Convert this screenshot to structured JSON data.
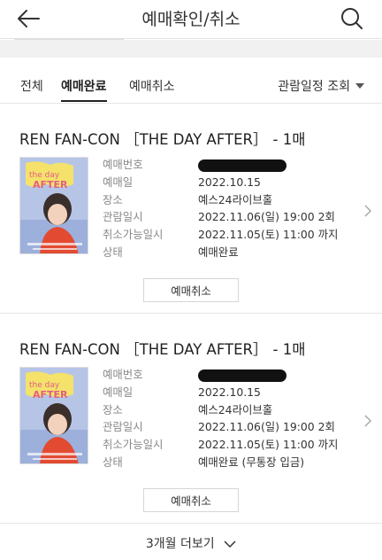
{
  "header": {
    "title": "예매확인/취소",
    "back_icon": "back-arrow-icon",
    "search_icon": "search-icon"
  },
  "tabs": [
    {
      "label": "전체",
      "active": false
    },
    {
      "label": "예매완료",
      "active": true
    },
    {
      "label": "예매취소",
      "active": false
    }
  ],
  "sort": {
    "label": "관람일정 조회",
    "icon": "caret-down-icon"
  },
  "bookings": [
    {
      "title": "REN FAN-CON ［THE DAY AFTER］",
      "quantity": "- 1매",
      "poster_icon": "poster-image",
      "fields": {
        "booking_number_label": "예매번호",
        "booking_date_label": "예매일",
        "booking_date": "2022.10.15",
        "venue_label": "장소",
        "venue": "예스24라이브홀",
        "show_datetime_label": "관람일시",
        "show_datetime": "2022.11.06(일) 19:00 2회",
        "cancel_deadline_label": "취소가능일시",
        "cancel_deadline": "2022.11.05(토) 11:00 까지",
        "status_label": "상태",
        "status": "예매완료"
      },
      "cancel_label": "예매취소"
    },
    {
      "title": "REN FAN-CON ［THE DAY AFTER］",
      "quantity": "- 1매",
      "poster_icon": "poster-image",
      "fields": {
        "booking_number_label": "예매번호",
        "booking_date_label": "예매일",
        "booking_date": "2022.10.15",
        "venue_label": "장소",
        "venue": "예스24라이브홀",
        "show_datetime_label": "관람일시",
        "show_datetime": "2022.11.06(일) 19:00 2회",
        "cancel_deadline_label": "취소가능일시",
        "cancel_deadline": "2022.11.05(토) 11:00 까지",
        "status_label": "상태",
        "status": "예매완료 (무통장 입금)"
      },
      "cancel_label": "예매취소"
    }
  ],
  "more": {
    "label": "3개월 더보기",
    "icon": "chevron-down-icon"
  },
  "colors": {
    "text": "#222222",
    "label_gray": "#888888",
    "divider": "#e6e6e6",
    "band": "#f1f1f1"
  }
}
